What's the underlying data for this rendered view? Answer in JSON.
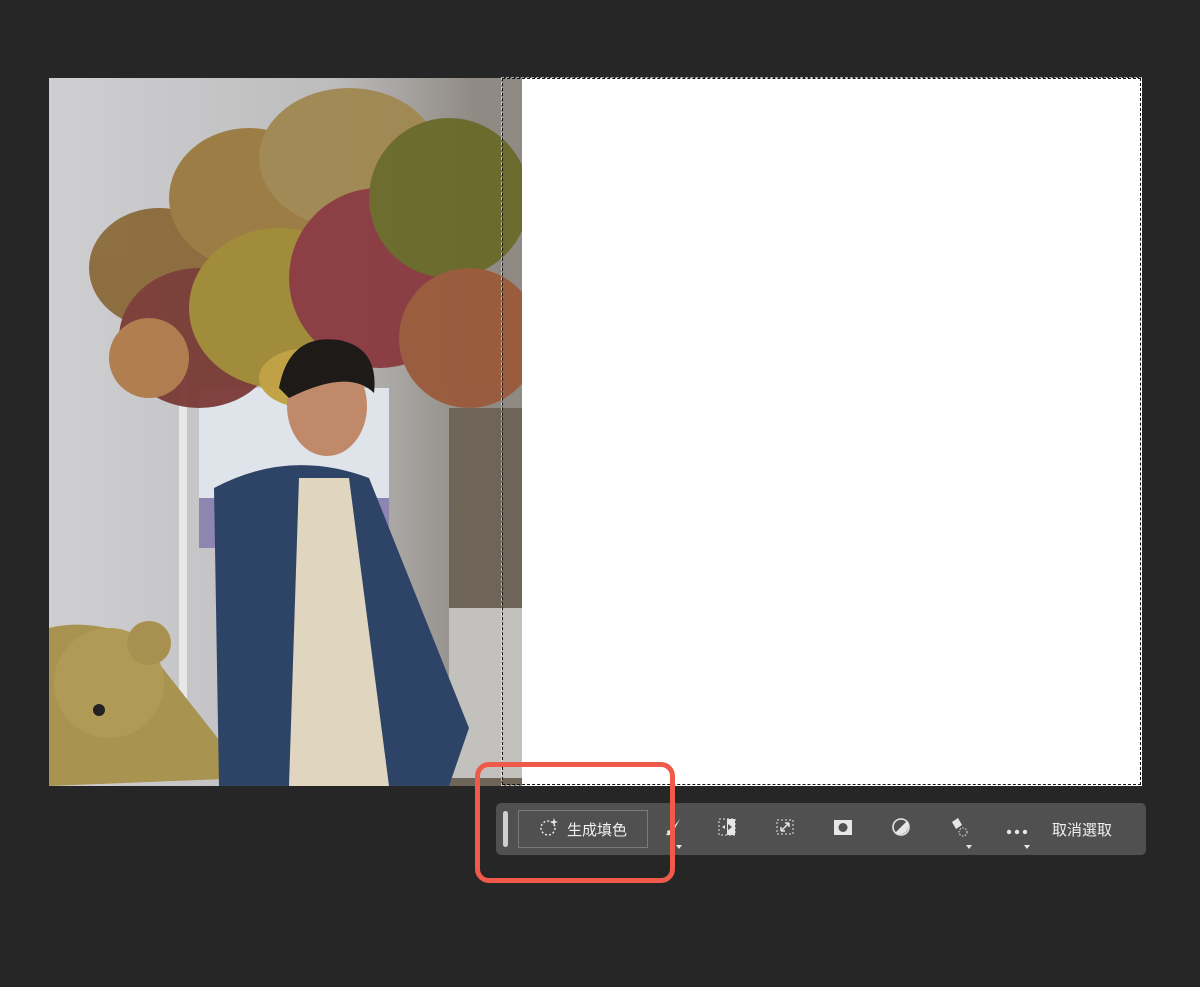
{
  "toolbar": {
    "generate_fill_label": "生成填色",
    "deselect_label": "取消選取",
    "tools": [
      {
        "icon": "brush-icon",
        "has_menu": true
      },
      {
        "icon": "invert-selection-icon",
        "has_menu": false
      },
      {
        "icon": "transform-selection-icon",
        "has_menu": false
      },
      {
        "icon": "mask-icon",
        "has_menu": false
      },
      {
        "icon": "adjustment-layer-icon",
        "has_menu": false
      },
      {
        "icon": "fill-bucket-icon",
        "has_menu": true
      },
      {
        "icon": "more-icon",
        "has_menu": true
      }
    ]
  },
  "colors": {
    "background": "#262626",
    "toolbar": "#505050",
    "highlight": "#f05a4a"
  }
}
